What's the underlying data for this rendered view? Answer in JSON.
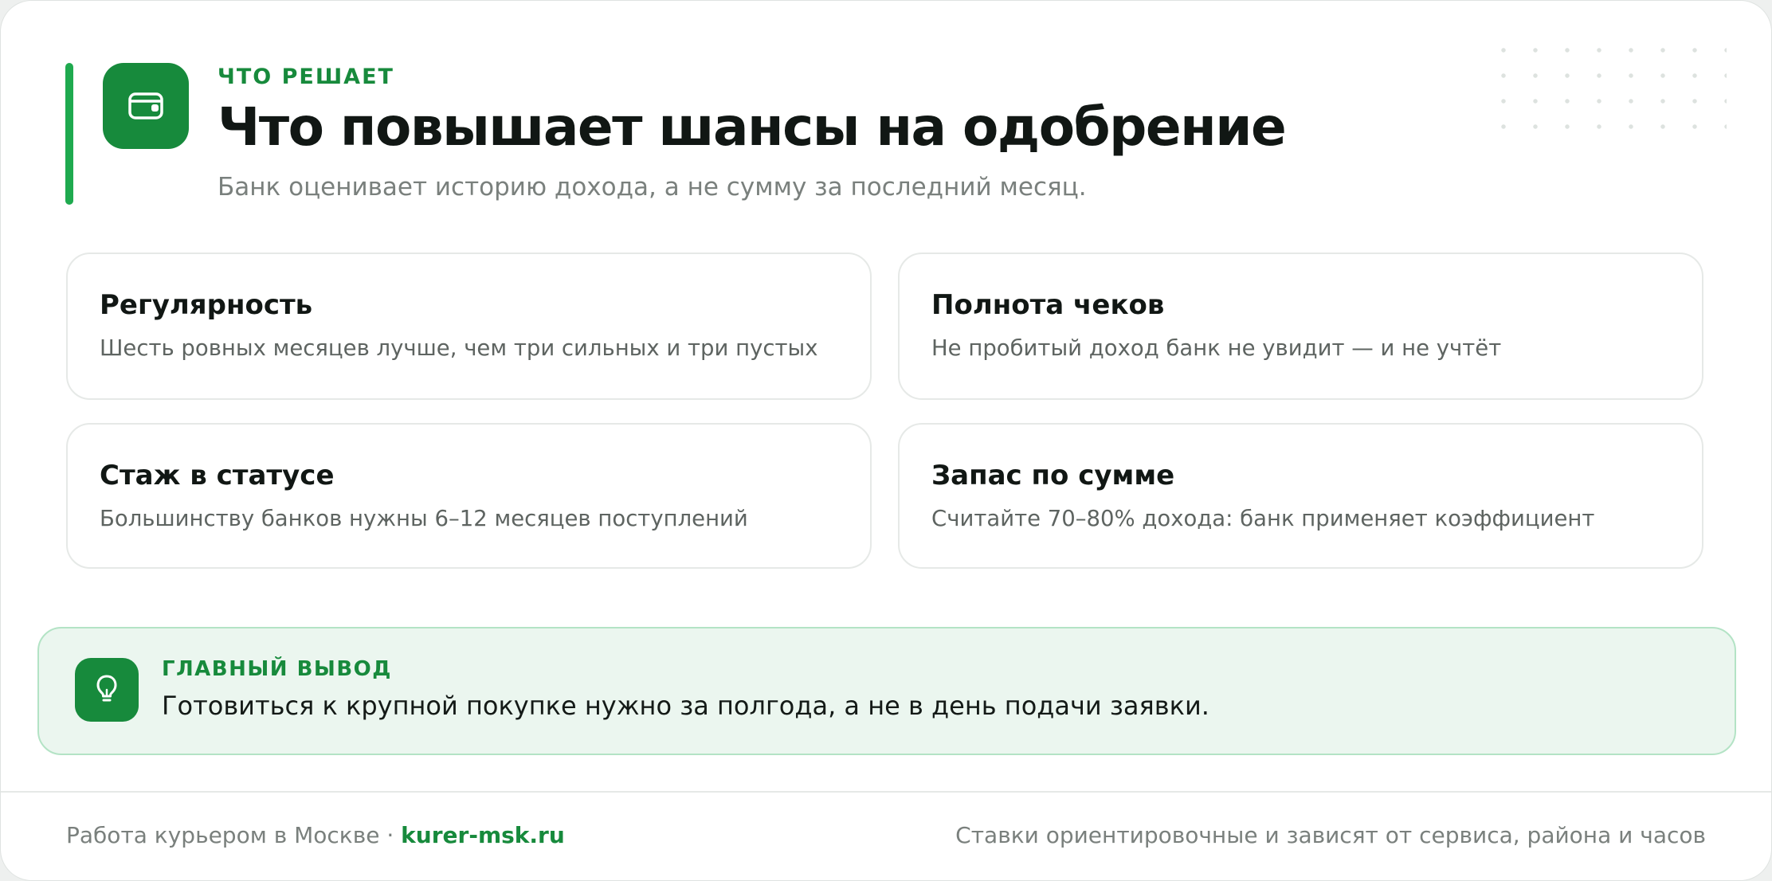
{
  "header": {
    "eyebrow": "ЧТО РЕШАЕТ",
    "title": "Что повышает шансы на одобрение",
    "subtitle": "Банк оценивает историю дохода, а не сумму за последний месяц.",
    "icon": "wallet-icon"
  },
  "cards": [
    {
      "title": "Регулярность",
      "text": "Шесть ровных месяцев лучше, чем три сильных и три пустых"
    },
    {
      "title": "Полнота чеков",
      "text": "Не пробитый доход банк не увидит — и не учтёт"
    },
    {
      "title": "Стаж в статусе",
      "text": "Большинству банков нужны 6–12 месяцев поступлений"
    },
    {
      "title": "Запас по сумме",
      "text": "Считайте 70–80% дохода: банк применяет коэффициент"
    }
  ],
  "tip": {
    "label": "ГЛАВНЫЙ ВЫВОД",
    "text": "Готовиться к крупной покупке нужно за полгода, а не в день подачи заявки.",
    "icon": "lightbulb-icon"
  },
  "footer": {
    "left_text": "Работа курьером в Москве · ",
    "site": "kurer-msk.ru",
    "right_text": "Ставки ориентировочные и зависят от сервиса, района и часов"
  },
  "colors": {
    "accent": "#178a3c",
    "accent_bar": "#1faa4f",
    "tip_background": "#ebf6ef",
    "tip_border": "#b3e3c5"
  }
}
